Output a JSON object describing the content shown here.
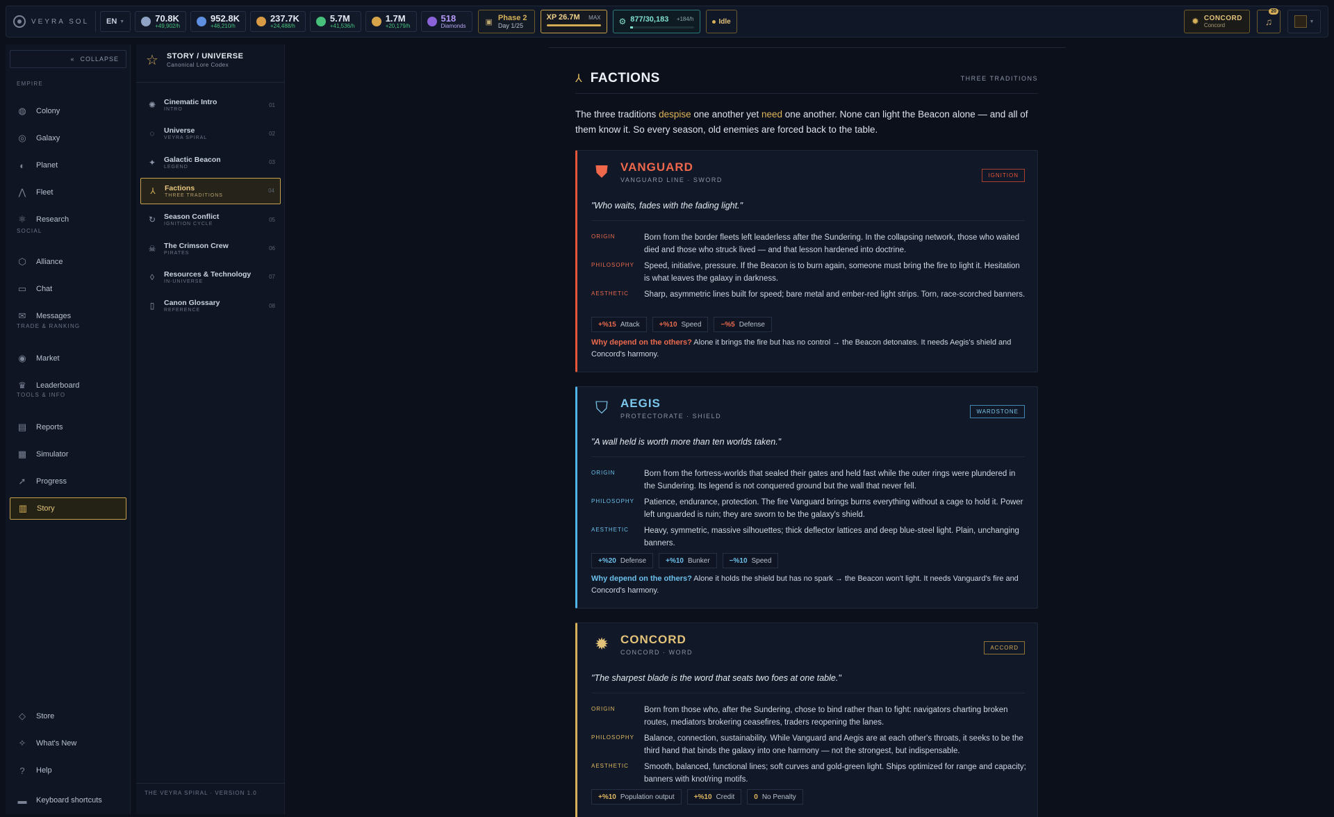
{
  "brand": {
    "name": "VEYRA SOL"
  },
  "topbar": {
    "lang": "EN",
    "resources": [
      {
        "value": "70.8K",
        "rate": "+49,902/h",
        "color": "#8fa4c4",
        "icon": "metal-icon"
      },
      {
        "value": "952.8K",
        "rate": "+46,210/h",
        "color": "#5e8fe0",
        "icon": "crystal-icon"
      },
      {
        "value": "237.7K",
        "rate": "+24,488/h",
        "color": "#d89a45",
        "icon": "energy-icon"
      },
      {
        "value": "5.7M",
        "rate": "+41,536/h",
        "color": "#46c07a",
        "icon": "organic-icon"
      },
      {
        "value": "1.7M",
        "rate": "+20,179/h",
        "color": "#d7a44a",
        "icon": "gold-icon"
      }
    ],
    "diamonds": {
      "value": "518",
      "label": "Diamonds"
    },
    "phase": {
      "title": "Phase 2",
      "sub": "Day 1/25"
    },
    "xp": {
      "value": "XP 26.7M",
      "label": "MAX"
    },
    "population": {
      "value": "877/30,183",
      "rate": "+184/h"
    },
    "status": "Idle",
    "faction": {
      "name": "CONCORD",
      "sub": "Concord"
    },
    "notifications": "20"
  },
  "nav": {
    "collapse": "COLLAPSE",
    "sections": {
      "empire": "EMPIRE",
      "social": "SOCIAL",
      "trade": "TRADE & RANKING",
      "tools": "TOOLS & INFO"
    },
    "items": [
      {
        "label": "Colony",
        "icon": "colony-icon",
        "glyph": "◍"
      },
      {
        "label": "Galaxy",
        "icon": "galaxy-icon",
        "glyph": "◎"
      },
      {
        "label": "Planet",
        "icon": "planet-icon",
        "glyph": "◐"
      },
      {
        "label": "Fleet",
        "icon": "fleet-icon",
        "glyph": "⋀"
      },
      {
        "label": "Research",
        "icon": "research-icon",
        "glyph": "⚛"
      },
      {
        "label": "Alliance",
        "icon": "alliance-icon",
        "glyph": "⬡"
      },
      {
        "label": "Chat",
        "icon": "chat-icon",
        "glyph": "▭"
      },
      {
        "label": "Messages",
        "icon": "messages-icon",
        "glyph": "✉"
      },
      {
        "label": "Market",
        "icon": "market-icon",
        "glyph": "◉"
      },
      {
        "label": "Leaderboard",
        "icon": "leaderboard-icon",
        "glyph": "♛"
      },
      {
        "label": "Reports",
        "icon": "reports-icon",
        "glyph": "▤"
      },
      {
        "label": "Simulator",
        "icon": "simulator-icon",
        "glyph": "▦"
      },
      {
        "label": "Progress",
        "icon": "progress-icon",
        "glyph": "➚"
      },
      {
        "label": "Story",
        "icon": "book-icon",
        "glyph": "▥"
      },
      {
        "label": "Store",
        "icon": "store-icon",
        "glyph": "◇"
      },
      {
        "label": "What's New",
        "icon": "sparkle-icon",
        "glyph": "✧"
      },
      {
        "label": "Help",
        "icon": "help-icon",
        "glyph": "?"
      },
      {
        "label": "Keyboard shortcuts",
        "icon": "keyboard-icon",
        "glyph": "▬"
      }
    ]
  },
  "story": {
    "title": "STORY / UNIVERSE",
    "subtitle": "Canonical Lore Codex",
    "chapters": [
      {
        "title": "Cinematic Intro",
        "sub": "INTRO",
        "num": "01",
        "glyph": "✺"
      },
      {
        "title": "Universe",
        "sub": "VEYRA SPIRAL",
        "num": "02",
        "glyph": "◌"
      },
      {
        "title": "Galactic Beacon",
        "sub": "LEGEND",
        "num": "03",
        "glyph": "✦"
      },
      {
        "title": "Factions",
        "sub": "THREE TRADITIONS",
        "num": "04",
        "glyph": "⅄"
      },
      {
        "title": "Season Conflict",
        "sub": "IGNITION CYCLE",
        "num": "05",
        "glyph": "↻"
      },
      {
        "title": "The Crimson Crew",
        "sub": "PIRATES",
        "num": "06",
        "glyph": "☠"
      },
      {
        "title": "Resources & Technology",
        "sub": "IN-UNIVERSE",
        "num": "07",
        "glyph": "◊"
      },
      {
        "title": "Canon Glossary",
        "sub": "REFERENCE",
        "num": "08",
        "glyph": "▯"
      }
    ],
    "footer": "THE VEYRA SPIRAL · VERSION 1.0"
  },
  "main": {
    "section_title": "FACTIONS",
    "section_tag": "THREE TRADITIONS",
    "intro": {
      "p1": "The three traditions ",
      "h1": "despise",
      "p2": " one another yet ",
      "h2": "need",
      "p3": " one another. None can light the Beacon alone — and all of them know it. So every season, old enemies are forced back to the table."
    },
    "factions": [
      {
        "name": "VANGUARD",
        "line": "VANGUARD LINE · SWORD",
        "tag": "IGNITION",
        "quote": "\"Who waits, fades with the fading light.\"",
        "labels": {
          "origin": "ORIGIN",
          "philosophy": "PHILOSOPHY",
          "aesthetic": "AESTHETIC"
        },
        "origin": "Born from the border fleets left leaderless after the Sundering. In the collapsing network, those who waited died and those who struck lived — and that lesson hardened into doctrine.",
        "philosophy": "Speed, initiative, pressure. If the Beacon is to burn again, someone must bring the fire to light it. Hesitation is what leaves the galaxy in darkness.",
        "aesthetic": "Sharp, asymmetric lines built for speed; bare metal and ember-red light strips. Torn, race-scorched banners.",
        "mods": [
          {
            "value": "+%15",
            "label": "Attack"
          },
          {
            "value": "+%10",
            "label": "Speed"
          },
          {
            "value": "−%5",
            "label": "Defense"
          }
        ],
        "why_q": "Why depend on the others?",
        "why": " Alone it brings the fire but has no control → the Beacon detonates. It needs Aegis's shield and Concord's harmony."
      },
      {
        "name": "AEGIS",
        "line": "PROTECTORATE · SHIELD",
        "tag": "WARDSTONE",
        "quote": "\"A wall held is worth more than ten worlds taken.\"",
        "labels": {
          "origin": "ORIGIN",
          "philosophy": "PHILOSOPHY",
          "aesthetic": "AESTHETIC"
        },
        "origin": "Born from the fortress-worlds that sealed their gates and held fast while the outer rings were plundered in the Sundering. Its legend is not conquered ground but the wall that never fell.",
        "philosophy": "Patience, endurance, protection. The fire Vanguard brings burns everything without a cage to hold it. Power left unguarded is ruin; they are sworn to be the galaxy's shield.",
        "aesthetic": "Heavy, symmetric, massive silhouettes; thick deflector lattices and deep blue-steel light. Plain, unchanging banners.",
        "mods": [
          {
            "value": "+%20",
            "label": "Defense"
          },
          {
            "value": "+%10",
            "label": "Bunker"
          },
          {
            "value": "−%10",
            "label": "Speed"
          }
        ],
        "why_q": "Why depend on the others?",
        "why": " Alone it holds the shield but has no spark → the Beacon won't light. It needs Vanguard's fire and Concord's harmony."
      },
      {
        "name": "CONCORD",
        "line": "CONCORD · WORD",
        "tag": "ACCORD",
        "quote": "\"The sharpest blade is the word that seats two foes at one table.\"",
        "labels": {
          "origin": "ORIGIN",
          "philosophy": "PHILOSOPHY",
          "aesthetic": "AESTHETIC"
        },
        "origin": "Born from those who, after the Sundering, chose to bind rather than to fight: navigators charting broken routes, mediators brokering ceasefires, traders reopening the lanes.",
        "philosophy": "Balance, connection, sustainability. While Vanguard and Aegis are at each other's throats, it seeks to be the third hand that binds the galaxy into one harmony — not the strongest, but indispensable.",
        "aesthetic": "Smooth, balanced, functional lines; soft curves and gold-green light. Ships optimized for range and capacity; banners with knot/ring motifs.",
        "mods": [
          {
            "value": "+%10",
            "label": "Population output"
          },
          {
            "value": "+%10",
            "label": "Credit"
          },
          {
            "value": "0",
            "label": "No Penalty"
          }
        ]
      }
    ]
  }
}
